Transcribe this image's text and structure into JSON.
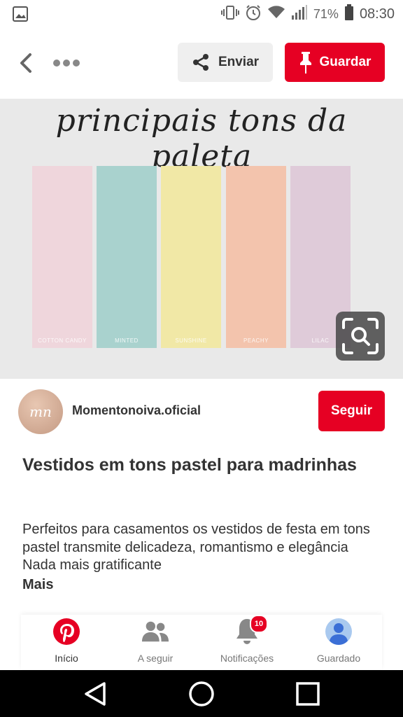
{
  "status_bar": {
    "battery_percent": "71%",
    "time": "08:30",
    "icons": [
      "image-icon",
      "vibrate-icon",
      "alarm-icon",
      "wifi-icon",
      "signal-icon",
      "battery-icon"
    ]
  },
  "topbar": {
    "send_label": "Enviar",
    "save_label": "Guardar"
  },
  "pin_image": {
    "title": "principais tons da paleta",
    "swatches": [
      {
        "label": "COTTON CANDY",
        "color": "#efd6dc"
      },
      {
        "label": "MINTED",
        "color": "#a9d2ce"
      },
      {
        "label": "SUNSHINE",
        "color": "#f1e8a6"
      },
      {
        "label": "PEACHY",
        "color": "#f3c4ad"
      },
      {
        "label": "LILAC",
        "color": "#dfcbd9"
      }
    ]
  },
  "creator": {
    "name": "Momentonoiva.oficial",
    "avatar_text": "mn",
    "follow_label": "Seguir"
  },
  "pin": {
    "title": "Vestidos em tons pastel para madrinhas",
    "description": "Perfeitos para casamentos os vestidos de festa em tons pastel transmite delicadeza, romantismo e elegância Nada mais gratificante",
    "more_label": "Mais"
  },
  "bottom_nav": {
    "items": [
      {
        "label": "Início",
        "icon": "pinterest-icon",
        "active": true
      },
      {
        "label": "A seguir",
        "icon": "people-icon",
        "active": false
      },
      {
        "label": "Notificações",
        "icon": "bell-icon",
        "active": false,
        "badge": "10"
      },
      {
        "label": "Guardado",
        "icon": "profile-icon",
        "active": false
      }
    ]
  },
  "colors": {
    "brand_red": "#e60023",
    "text_dark": "#333333",
    "android_nav_bg": "#000000"
  }
}
